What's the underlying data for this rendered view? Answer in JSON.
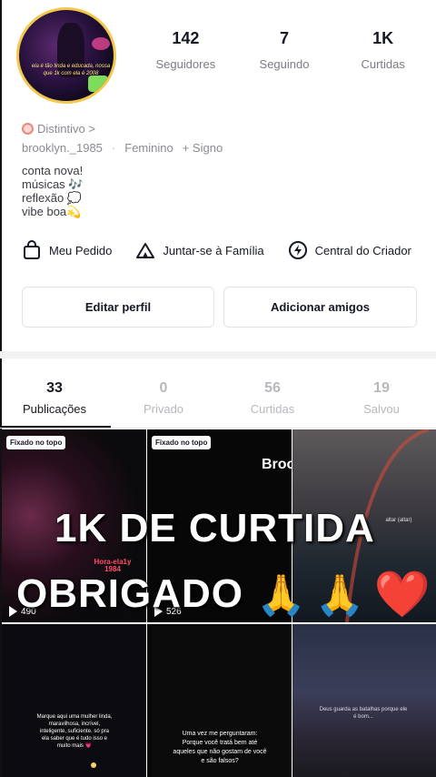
{
  "profile": {
    "stats": [
      {
        "value": "142",
        "label": "Seguidores"
      },
      {
        "value": "7",
        "label": "Seguindo"
      },
      {
        "value": "1K",
        "label": "Curtidas"
      }
    ],
    "badge": "Distintivo >",
    "username": "brooklyn._1985",
    "gender": "Feminino",
    "sign": "+ Signo",
    "bio": [
      "conta nova!",
      "músicas 🎶",
      "reflexão 💭",
      "vibe boa💫"
    ],
    "avatar_caption": "ela é tão linda e educada, nossa que 1k com ela é 2008"
  },
  "actions": [
    {
      "icon": "shopping-bag-icon",
      "label": "Meu Pedido"
    },
    {
      "icon": "family-tent-icon",
      "label": "Juntar-se à Família"
    },
    {
      "icon": "creator-bolt-icon",
      "label": "Central do Criador"
    }
  ],
  "buttons": {
    "edit": "Editar perfil",
    "add": "Adicionar amigos"
  },
  "tabs": [
    {
      "count": "33",
      "label": "Publicações"
    },
    {
      "count": "0",
      "label": "Privado"
    },
    {
      "count": "56",
      "label": "Curtidas"
    },
    {
      "count": "19",
      "label": "Salvou"
    }
  ],
  "grid": {
    "pinned_label": "Fixado no topo",
    "cells": [
      {
        "views": "490",
        "text": "Hora-ela1y 1984"
      },
      {
        "views": "526",
        "text": "Broo"
      },
      {
        "views": "",
        "text": "altar (altar)"
      },
      {
        "views": "",
        "text": "Marque aqui uma mulher linda, maravilhosa, incrível, inteligente, suficiente. só pra ela saber que é tudo isso e muito mais 💗"
      },
      {
        "views": "",
        "text": "Uma vez me perguntaram: Porque você tratá bem até aqueles que não gostam de você e são falsos?"
      },
      {
        "views": "",
        "text": "Deus guarda as batalhas porque ele é bom..."
      }
    ]
  },
  "overlay": {
    "line1": "1K DE CURTIDA",
    "line2": "OBRIGADO",
    "emojis": [
      "🙏",
      "🙏",
      "❤️"
    ]
  },
  "colors": {
    "accent_text": "#161823",
    "muted": "#7a7c85",
    "badge": "#e8887e"
  }
}
